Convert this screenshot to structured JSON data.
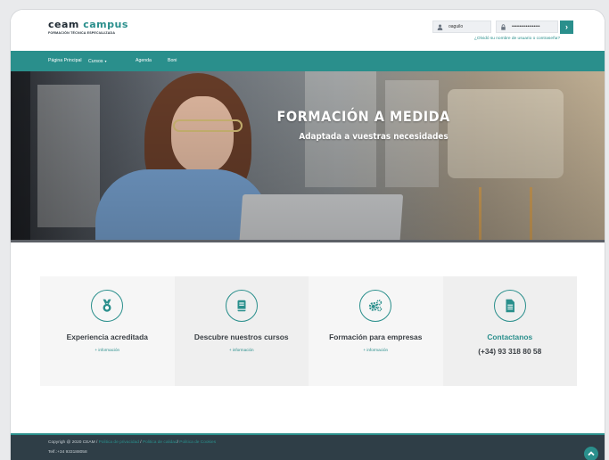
{
  "header": {
    "logo_main_part1": "ceam ",
    "logo_main_part2": "campus",
    "logo_sub": "FORMACIÓN TÉCNICA ESPECIALIZADA",
    "username_value": "oaguilo",
    "password_value": "••••••••••••••••••",
    "forgot_text": "¿Olvidó su nombre de usuario o contraseña?"
  },
  "nav": {
    "items": [
      {
        "label": "Página Principal"
      },
      {
        "label": "Cursos"
      },
      {
        "label": "Agenda"
      },
      {
        "label": "Boni"
      }
    ]
  },
  "hero": {
    "title": "FORMACIÓN A MEDIDA",
    "subtitle": "Adaptada a vuestras necesidades"
  },
  "features": [
    {
      "title": "Experiencia acreditada",
      "link": "+ información",
      "icon": "medal-icon"
    },
    {
      "title": "Descubre nuestros cursos",
      "link": "+ información",
      "icon": "book-icon"
    },
    {
      "title": "Formación  para empresas",
      "link": "+ información",
      "icon": "gears-icon"
    },
    {
      "title": "Contactanos",
      "phone": "(+34) 93 318 80 58",
      "icon": "document-icon"
    }
  ],
  "footer": {
    "copyright": "Copyrigh @ 2020 CEAM",
    "sep1": " / ",
    "privacy": "Politica de privacidad",
    "sep2": " / ",
    "quality": "Politica de calidad",
    "sep3": "/ ",
    "cookies": "Politica de Cookies",
    "phone": "Telf.:+34 933188058"
  },
  "colors": {
    "accent": "#2a8f8c",
    "footer_bg": "#2f3e47",
    "text_dark": "#3a3f44"
  }
}
